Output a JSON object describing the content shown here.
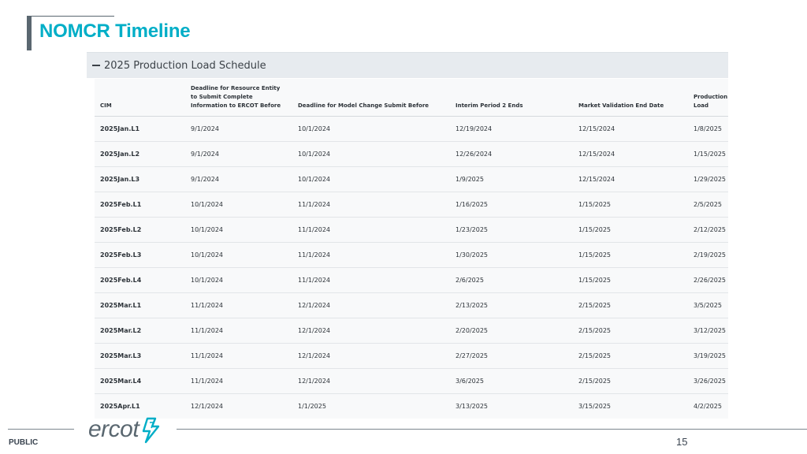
{
  "slide": {
    "title": "NOMCR Timeline",
    "page_number": "15",
    "classification": "PUBLIC",
    "logo_text": "ercot",
    "brand_color": "#00aec7"
  },
  "panel": {
    "header": "2025 Production Load Schedule",
    "toggle_icon": "minus-icon"
  },
  "table": {
    "columns": [
      "CIM",
      "Deadline for Resource Entity to Submit Complete Information to ERCOT Before",
      "Deadline for Model Change Submit Before",
      "Interim Period 2 Ends",
      "Market Validation End Date",
      "Production Load"
    ],
    "rows": [
      [
        "2025Jan.L1",
        "9/1/2024",
        "10/1/2024",
        "12/19/2024",
        "12/15/2024",
        "1/8/2025"
      ],
      [
        "2025Jan.L2",
        "9/1/2024",
        "10/1/2024",
        "12/26/2024",
        "12/15/2024",
        "1/15/2025"
      ],
      [
        "2025Jan.L3",
        "9/1/2024",
        "10/1/2024",
        "1/9/2025",
        "12/15/2024",
        "1/29/2025"
      ],
      [
        "2025Feb.L1",
        "10/1/2024",
        "11/1/2024",
        "1/16/2025",
        "1/15/2025",
        "2/5/2025"
      ],
      [
        "2025Feb.L2",
        "10/1/2024",
        "11/1/2024",
        "1/23/2025",
        "1/15/2025",
        "2/12/2025"
      ],
      [
        "2025Feb.L3",
        "10/1/2024",
        "11/1/2024",
        "1/30/2025",
        "1/15/2025",
        "2/19/2025"
      ],
      [
        "2025Feb.L4",
        "10/1/2024",
        "11/1/2024",
        "2/6/2025",
        "1/15/2025",
        "2/26/2025"
      ],
      [
        "2025Mar.L1",
        "11/1/2024",
        "12/1/2024",
        "2/13/2025",
        "2/15/2025",
        "3/5/2025"
      ],
      [
        "2025Mar.L2",
        "11/1/2024",
        "12/1/2024",
        "2/20/2025",
        "2/15/2025",
        "3/12/2025"
      ],
      [
        "2025Mar.L3",
        "11/1/2024",
        "12/1/2024",
        "2/27/2025",
        "2/15/2025",
        "3/19/2025"
      ],
      [
        "2025Mar.L4",
        "11/1/2024",
        "12/1/2024",
        "3/6/2025",
        "2/15/2025",
        "3/26/2025"
      ],
      [
        "2025Apr.L1",
        "12/1/2024",
        "1/1/2025",
        "3/13/2025",
        "3/15/2025",
        "4/2/2025"
      ]
    ]
  }
}
